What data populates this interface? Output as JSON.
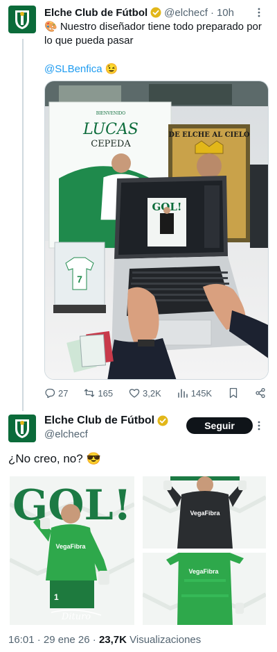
{
  "tweet1": {
    "name": "Elche Club de Fútbol",
    "handle": "@elchecf",
    "separator": "·",
    "time": "10h",
    "text": "🎨 Nuestro diseñador tiene todo preparado por lo que pueda pasar",
    "mention": "@SLBenfica",
    "emoji": "😉",
    "image": {
      "poster_welcome": "BIENVENIDO",
      "poster_name1": "LUCAS",
      "poster_name2": "CEPEDA",
      "banner_text": "DE ELCHE AL CIELO",
      "screen_text": "GOL!",
      "shirt_number": "7"
    },
    "actions": {
      "replies": "27",
      "reposts": "165",
      "likes": "3,2K",
      "views": "145K"
    }
  },
  "tweet2": {
    "name": "Elche Club de Fútbol",
    "handle": "@elchecf",
    "follow_label": "Seguir",
    "text": "¿No creo, no? 😎",
    "image": {
      "headline": "GOL!",
      "sponsor": "VegaFibra",
      "number": "1",
      "signature": "Dituro"
    },
    "footer": {
      "time": "16:01 · 29 ene 26 · ",
      "views": "23,7K",
      "views_label": " Visualizaciones"
    }
  },
  "colors": {
    "accent": "#1d9bf0",
    "club_green": "#0b6b3a",
    "kit_green": "#2ea84b",
    "verified_gold": "#e2b719"
  }
}
